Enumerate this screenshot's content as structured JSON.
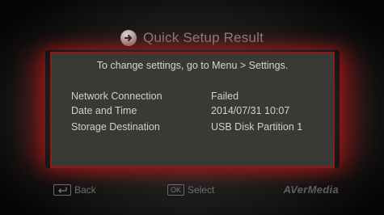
{
  "header": {
    "title": "Quick Setup Result",
    "icon": "arrow-right-circle-icon"
  },
  "panel": {
    "instruction": "To change settings, go to Menu > Settings.",
    "rows": [
      {
        "label": "Network Connection",
        "value": "Failed"
      },
      {
        "label": "Date and Time",
        "value": "2014/07/31 10:07"
      },
      {
        "label": "Storage Destination",
        "value": "USB Disk Partition 1"
      }
    ],
    "border_color": "#8e1b1b",
    "glow_color": "#b01818"
  },
  "footer": {
    "back_label": "Back",
    "select_key": "OK",
    "select_label": "Select",
    "brand": "AVerMedia",
    "back_icon": "return-arrow-icon"
  }
}
